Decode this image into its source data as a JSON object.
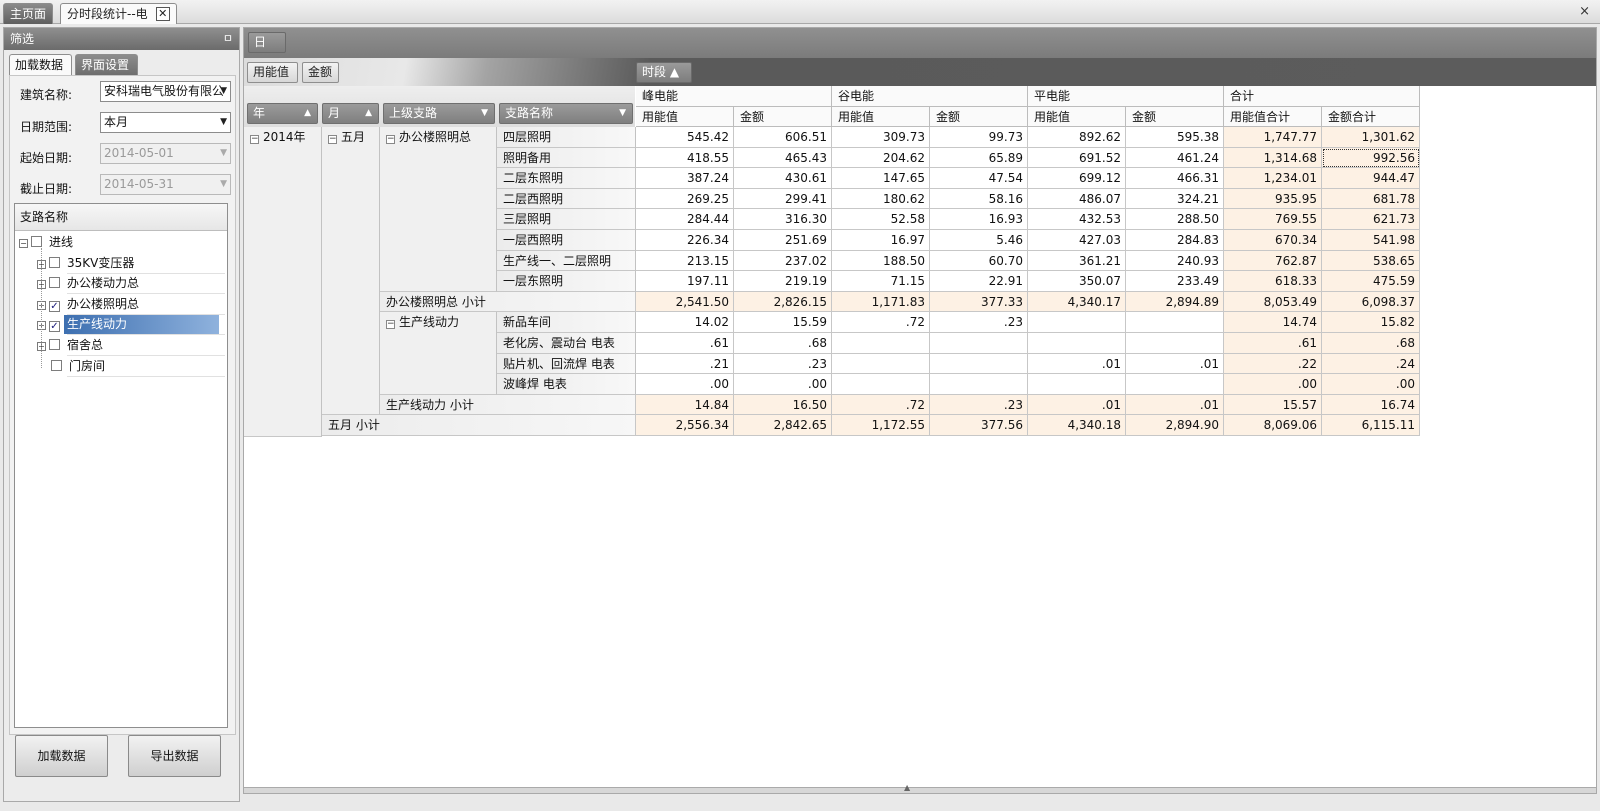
{
  "tabs": [
    {
      "label": "主页面"
    },
    {
      "label": "分时段统计--电",
      "close": "✕"
    }
  ],
  "window_close": "×",
  "filter_panel": {
    "title": "筛选",
    "pin": "ㅁ",
    "subtabs": [
      "加载数据",
      "界面设置"
    ],
    "building_label": "建筑名称:",
    "building_value": "安科瑞电气股份有限公",
    "date_range_label": "日期范围:",
    "date_range_value": "本月",
    "start_label": "起始日期:",
    "start_value": "2014-05-01",
    "end_label": "截止日期:",
    "end_value": "2014-05-31",
    "tree_header": "支路名称",
    "tree": [
      {
        "label": "进线",
        "checked": false,
        "expander": "−"
      },
      {
        "label": "35KV变压器",
        "checked": false,
        "expander": "+"
      },
      {
        "label": "办公楼动力总",
        "checked": false,
        "expander": "+"
      },
      {
        "label": "办公楼照明总",
        "checked": true,
        "expander": "+"
      },
      {
        "label": "生产线动力",
        "checked": true,
        "expander": "+"
      },
      {
        "label": "宿舍总",
        "checked": false,
        "expander": "+"
      },
      {
        "label": "门房间",
        "checked": false,
        "expander": ""
      }
    ],
    "load_button": "加载数据",
    "export_button": "导出数据"
  },
  "pivot": {
    "filter_field": "日",
    "data_fields": [
      "用能值",
      "金额"
    ],
    "column_field": "时段 ▲",
    "row_fields": [
      {
        "label": "年",
        "sort": "▲"
      },
      {
        "label": "月",
        "sort": "▲"
      },
      {
        "label": "上级支路",
        "sort": "▼"
      },
      {
        "label": "支路名称",
        "sort": "▼"
      }
    ],
    "column_groups": [
      "峰电能",
      "谷电能",
      "平电能",
      "合计"
    ],
    "measure_headers": [
      "用能值",
      "金额",
      "用能值",
      "金额",
      "用能值",
      "金额",
      "用能值合计",
      "金额合计"
    ],
    "filter_icon": "⧩",
    "year": "2014年",
    "month": "五月",
    "collapse_sign": "−",
    "groups": [
      {
        "parent": "办公楼照明总",
        "rows": [
          {
            "name": "四层照明",
            "values": [
              "545.42",
              "606.51",
              "309.73",
              "99.73",
              "892.62",
              "595.38",
              "1,747.77",
              "1,301.62"
            ]
          },
          {
            "name": "照明备用",
            "values": [
              "418.55",
              "465.43",
              "204.62",
              "65.89",
              "691.52",
              "461.24",
              "1,314.68",
              "992.56"
            ]
          },
          {
            "name": "二层东照明",
            "values": [
              "387.24",
              "430.61",
              "147.65",
              "47.54",
              "699.12",
              "466.31",
              "1,234.01",
              "944.47"
            ]
          },
          {
            "name": "二层西照明",
            "values": [
              "269.25",
              "299.41",
              "180.62",
              "58.16",
              "486.07",
              "324.21",
              "935.95",
              "681.78"
            ]
          },
          {
            "name": "三层照明",
            "values": [
              "284.44",
              "316.30",
              "52.58",
              "16.93",
              "432.53",
              "288.50",
              "769.55",
              "621.73"
            ]
          },
          {
            "name": "一层西照明",
            "values": [
              "226.34",
              "251.69",
              "16.97",
              "5.46",
              "427.03",
              "284.83",
              "670.34",
              "541.98"
            ]
          },
          {
            "name": "生产线一、二层照明",
            "values": [
              "213.15",
              "237.02",
              "188.50",
              "60.70",
              "361.21",
              "240.93",
              "762.87",
              "538.65"
            ]
          },
          {
            "name": "一层东照明",
            "values": [
              "197.11",
              "219.19",
              "71.15",
              "22.91",
              "350.07",
              "233.49",
              "618.33",
              "475.59"
            ]
          }
        ],
        "subtotal_label": "办公楼照明总 小计",
        "subtotal": [
          "2,541.50",
          "2,826.15",
          "1,171.83",
          "377.33",
          "4,340.17",
          "2,894.89",
          "8,053.49",
          "6,098.37"
        ]
      },
      {
        "parent": "生产线动力",
        "rows": [
          {
            "name": "新品车间",
            "values": [
              "14.02",
              "15.59",
              ".72",
              ".23",
              "",
              "",
              "14.74",
              "15.82"
            ]
          },
          {
            "name": "老化房、震动台 电表",
            "values": [
              ".61",
              ".68",
              "",
              "",
              "",
              "",
              ".61",
              ".68"
            ]
          },
          {
            "name": "贴片机、回流焊 电表",
            "values": [
              ".21",
              ".23",
              "",
              "",
              ".01",
              ".01",
              ".22",
              ".24"
            ]
          },
          {
            "name": "波峰焊 电表",
            "values": [
              ".00",
              ".00",
              "",
              "",
              "",
              "",
              ".00",
              ".00"
            ]
          }
        ],
        "subtotal_label": "生产线动力 小计",
        "subtotal": [
          "14.84",
          "16.50",
          ".72",
          ".23",
          ".01",
          ".01",
          "15.57",
          "16.74"
        ]
      }
    ],
    "month_subtotal_label": "五月 小计",
    "month_subtotal": [
      "2,556.34",
      "2,842.65",
      "1,172.55",
      "377.56",
      "4,340.18",
      "2,894.90",
      "8,069.06",
      "6,115.11"
    ],
    "grip": "▲"
  }
}
